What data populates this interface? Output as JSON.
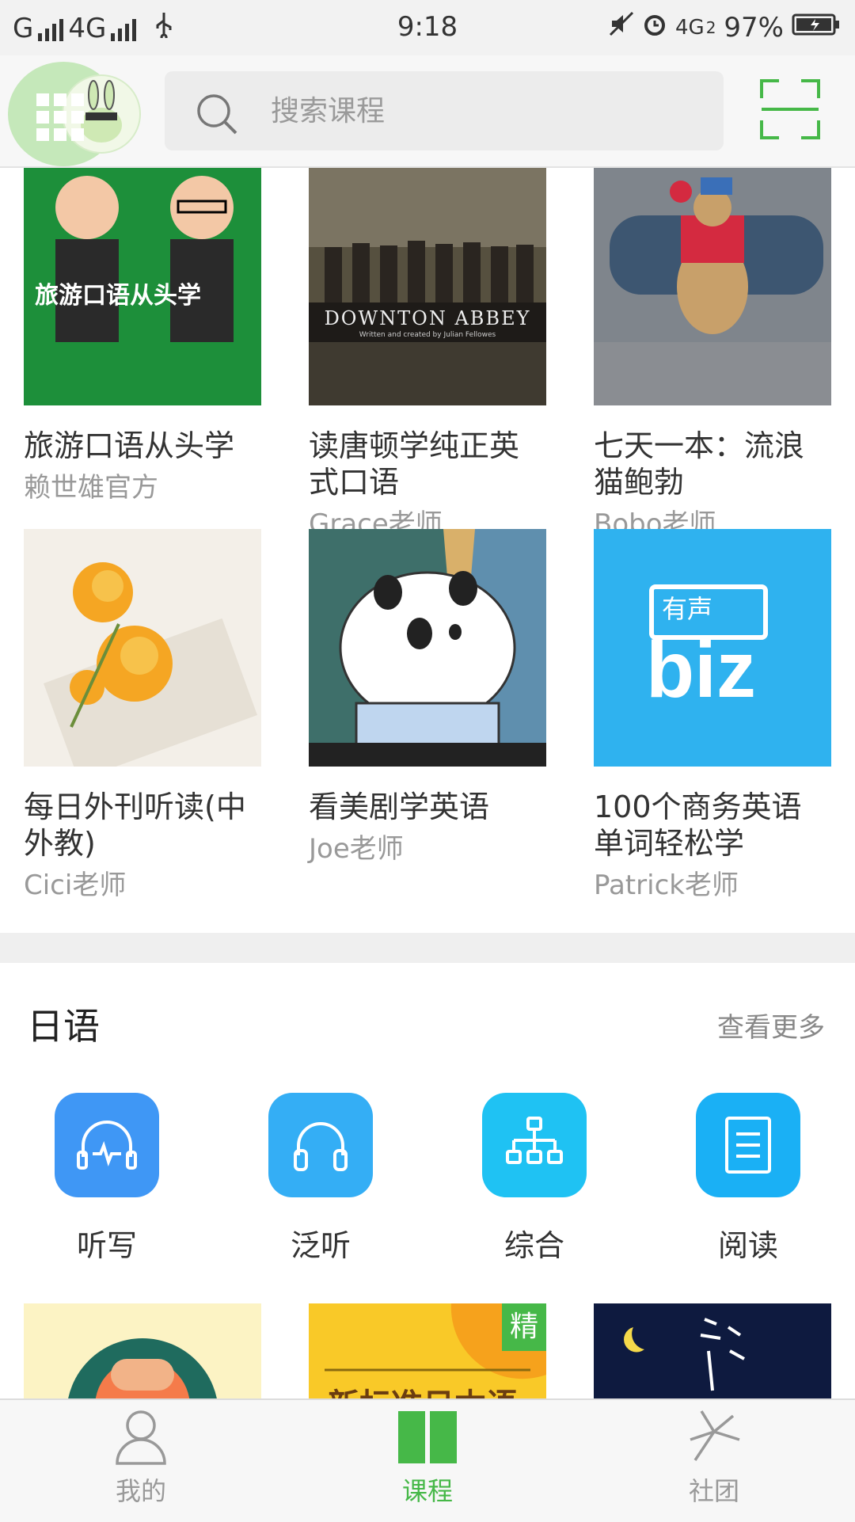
{
  "status_bar": {
    "carrier_left": "G",
    "network_1": "4G",
    "time": "9:18",
    "network_2": "4G",
    "sim_2": "2",
    "battery": "97%"
  },
  "top_bar": {
    "search_placeholder": "搜索课程"
  },
  "courses_row1": [
    {
      "title": "旅游口语从头学",
      "author": "赖世雄官方",
      "thumb_caption": "旅游口语从头学"
    },
    {
      "title": "读唐顿学纯正英式口语",
      "author": "Grace老师",
      "thumb_caption": "DOWNTON ABBEY",
      "thumb_sub": "Written and created by Julian Fellowes"
    },
    {
      "title": "七天一本：流浪猫鲍勃",
      "author": "Bobo老师"
    }
  ],
  "courses_row2": [
    {
      "title": "每日外刊听读(中外教)",
      "author": "Cici老师"
    },
    {
      "title": "看美剧学英语",
      "author": "Joe老师"
    },
    {
      "title": "100个商务英语单词轻松学",
      "author": "Patrick老师",
      "thumb_badge": "有声",
      "thumb_word": "biz"
    }
  ],
  "section": {
    "title": "日语",
    "view_more": "查看更多"
  },
  "categories": [
    {
      "label": "听写",
      "icon": "waveform-headphones-icon",
      "color": "#3f97f5"
    },
    {
      "label": "泛听",
      "icon": "headphones-icon",
      "color": "#34aef5"
    },
    {
      "label": "综合",
      "icon": "hierarchy-icon",
      "color": "#1fc2f3"
    },
    {
      "label": "阅读",
      "icon": "document-icon",
      "color": "#1ab0f5"
    }
  ],
  "bottom_row": {
    "badge": "精",
    "partial_text": "新标准日本语"
  },
  "tabbar": {
    "tabs": [
      {
        "label": "我的",
        "icon": "person-icon",
        "active": false
      },
      {
        "label": "课程",
        "icon": "book-icon",
        "active": true
      },
      {
        "label": "社团",
        "icon": "community-icon",
        "active": false
      }
    ]
  },
  "colors": {
    "accent_green": "#46b848",
    "inactive_gray": "#999999"
  }
}
